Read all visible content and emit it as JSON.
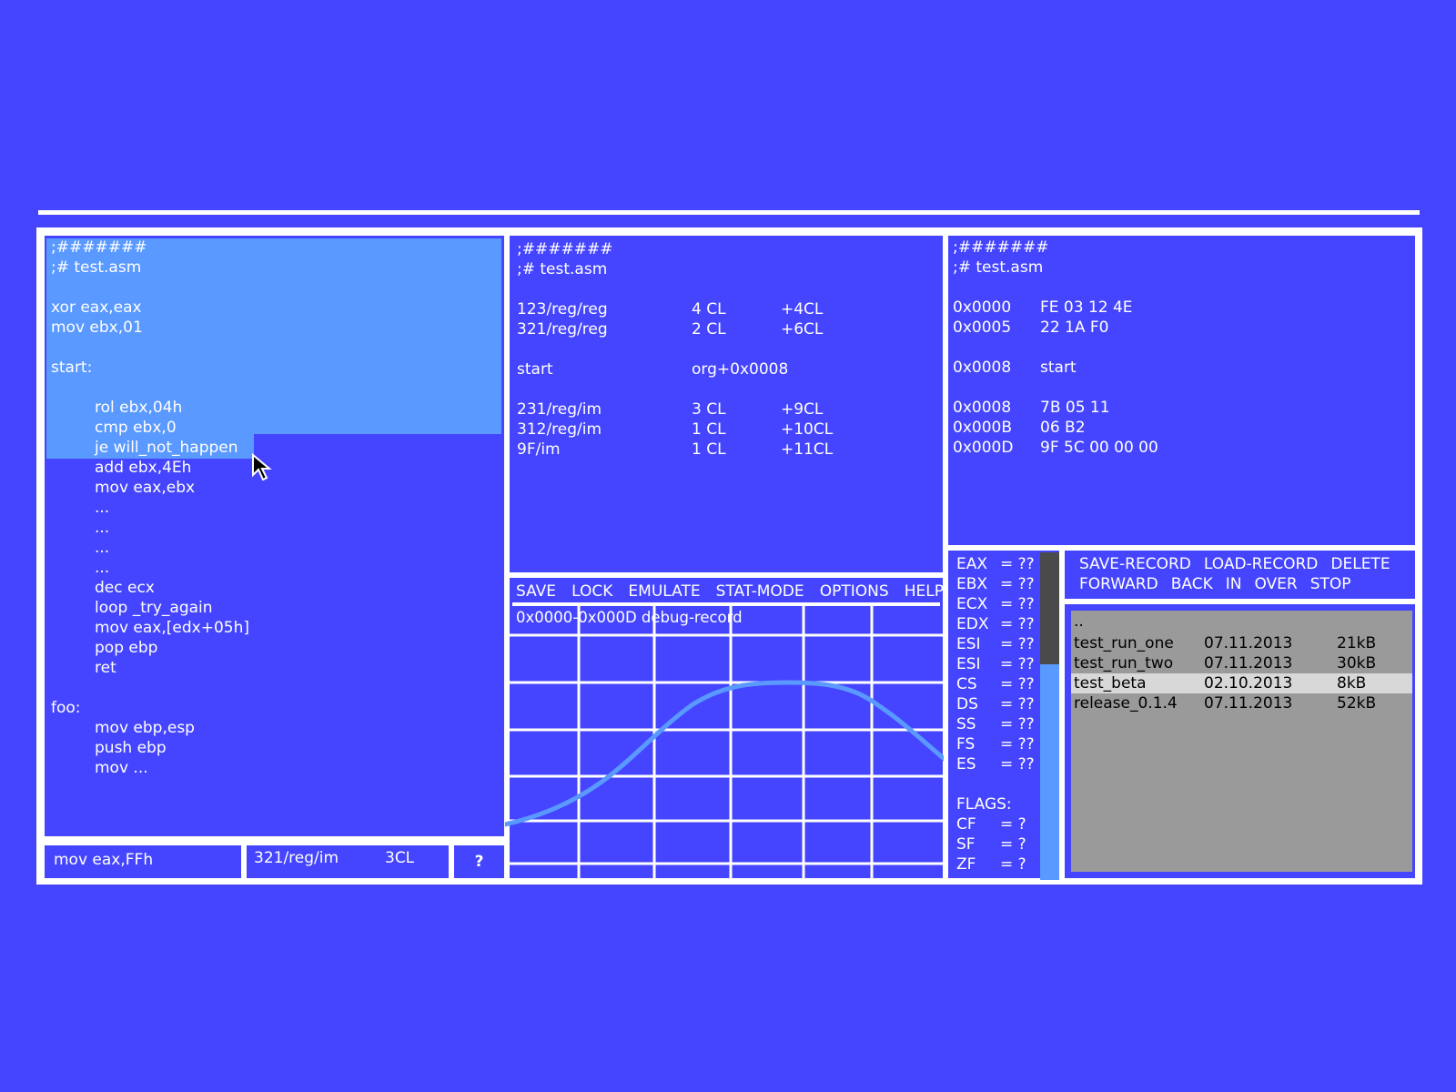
{
  "colors": {
    "background": "#4545ff",
    "border": "#ffffff",
    "selection": "#5a99ff",
    "file_panel": "#9a9a9a",
    "file_selected_row": "#d8d8d8",
    "scrollbar_track": "#4a4a4a",
    "scrollbar_thumb": "#5a99ff",
    "graph_line": "#5a99ff"
  },
  "source_panel": {
    "lines": [
      {
        "text": ";#######",
        "indent": false
      },
      {
        "text": ";# test.asm",
        "indent": false
      },
      {
        "text": "",
        "indent": false
      },
      {
        "text": "xor eax,eax",
        "indent": false
      },
      {
        "text": "mov ebx,01",
        "indent": false
      },
      {
        "text": "",
        "indent": false
      },
      {
        "text": "start:",
        "indent": false
      },
      {
        "text": "",
        "indent": false
      },
      {
        "text": "rol ebx,04h",
        "indent": true
      },
      {
        "text": "cmp ebx,0",
        "indent": true
      },
      {
        "text": "je will_not_happen",
        "indent": true
      },
      {
        "text": "add ebx,4Eh",
        "indent": true
      },
      {
        "text": "mov eax,ebx",
        "indent": true
      },
      {
        "text": "...",
        "indent": true
      },
      {
        "text": "...",
        "indent": true
      },
      {
        "text": "...",
        "indent": true
      },
      {
        "text": "...",
        "indent": true
      },
      {
        "text": "dec ecx",
        "indent": true
      },
      {
        "text": "loop _try_again",
        "indent": true
      },
      {
        "text": "mov eax,[edx+05h]",
        "indent": true
      },
      {
        "text": "pop ebp",
        "indent": true
      },
      {
        "text": "ret",
        "indent": true
      },
      {
        "text": "",
        "indent": false
      },
      {
        "text": "foo:",
        "indent": false
      },
      {
        "text": "mov ebp,esp",
        "indent": true
      },
      {
        "text": "push ebp",
        "indent": true
      },
      {
        "text": "mov ...",
        "indent": true
      }
    ]
  },
  "status_bar": {
    "instruction": "mov eax,FFh",
    "encoding": "321/reg/im",
    "cycles": "3CL",
    "help": "?"
  },
  "cycles_panel": {
    "header": [
      ";#######",
      ";# test.asm"
    ],
    "rows": [
      {
        "a": "123/reg/reg",
        "b": "4 CL",
        "c": "+4CL"
      },
      {
        "a": "321/reg/reg",
        "b": "2 CL",
        "c": "+6CL"
      },
      {
        "a": "",
        "b": "",
        "c": ""
      },
      {
        "a": "start",
        "b": "org+0x0008",
        "c": ""
      },
      {
        "a": "",
        "b": "",
        "c": ""
      },
      {
        "a": "231/reg/im",
        "b": "3 CL",
        "c": "+9CL"
      },
      {
        "a": "312/reg/im",
        "b": "1 CL",
        "c": "+10CL"
      },
      {
        "a": "9F/im",
        "b": "1 CL",
        "c": "+11CL"
      }
    ]
  },
  "hex_panel": {
    "header": [
      ";#######",
      ";# test.asm"
    ],
    "rows": [
      {
        "addr": "0x0000",
        "bytes": "FE 03 12 4E"
      },
      {
        "addr": "0x0005",
        "bytes": "22 1A F0"
      },
      {
        "addr": "",
        "bytes": ""
      },
      {
        "addr": "0x0008",
        "bytes": "start"
      },
      {
        "addr": "",
        "bytes": ""
      },
      {
        "addr": "0x0008",
        "bytes": "7B 05 11"
      },
      {
        "addr": "0x000B",
        "bytes": "06 B2"
      },
      {
        "addr": "0x000D",
        "bytes": "9F 5C 00 00 00"
      }
    ]
  },
  "graph_panel": {
    "menu": [
      "SAVE",
      "LOCK",
      "EMULATE",
      "STAT-MODE",
      "OPTIONS",
      "HELP"
    ],
    "range_label": "0x0000-0x000D debug-record"
  },
  "registers": [
    {
      "name": "EAX",
      "value": "= ??"
    },
    {
      "name": "EBX",
      "value": "= ??"
    },
    {
      "name": "ECX",
      "value": "= ??"
    },
    {
      "name": "EDX",
      "value": "= ??"
    },
    {
      "name": "ESI",
      "value": "= ??"
    },
    {
      "name": "ESI",
      "value": "= ??"
    },
    {
      "name": "CS",
      "value": "= ??"
    },
    {
      "name": "DS",
      "value": "= ??"
    },
    {
      "name": "SS",
      "value": "= ??"
    },
    {
      "name": "FS",
      "value": "= ??"
    },
    {
      "name": "ES",
      "value": "= ??"
    }
  ],
  "flags": {
    "title": "FLAGS:",
    "items": [
      {
        "name": "CF",
        "value": "= ?"
      },
      {
        "name": "SF",
        "value": "= ?"
      },
      {
        "name": "ZF",
        "value": "= ?"
      }
    ]
  },
  "record_menu": {
    "row1": [
      "SAVE-RECORD",
      "LOAD-RECORD",
      "DELETE"
    ],
    "row2": [
      "FORWARD",
      "BACK",
      "IN",
      "OVER",
      "STOP"
    ]
  },
  "file_list": {
    "parent": "..",
    "files": [
      {
        "name": "test_run_one",
        "date": "07.11.2013",
        "size": "21kB",
        "selected": false
      },
      {
        "name": "test_run_two",
        "date": "07.11.2013",
        "size": "30kB",
        "selected": false
      },
      {
        "name": "test_beta",
        "date": "02.10.2013",
        "size": "8kB",
        "selected": true
      },
      {
        "name": "release_0.1.4",
        "date": "07.11.2013",
        "size": "52kB",
        "selected": false
      }
    ]
  }
}
